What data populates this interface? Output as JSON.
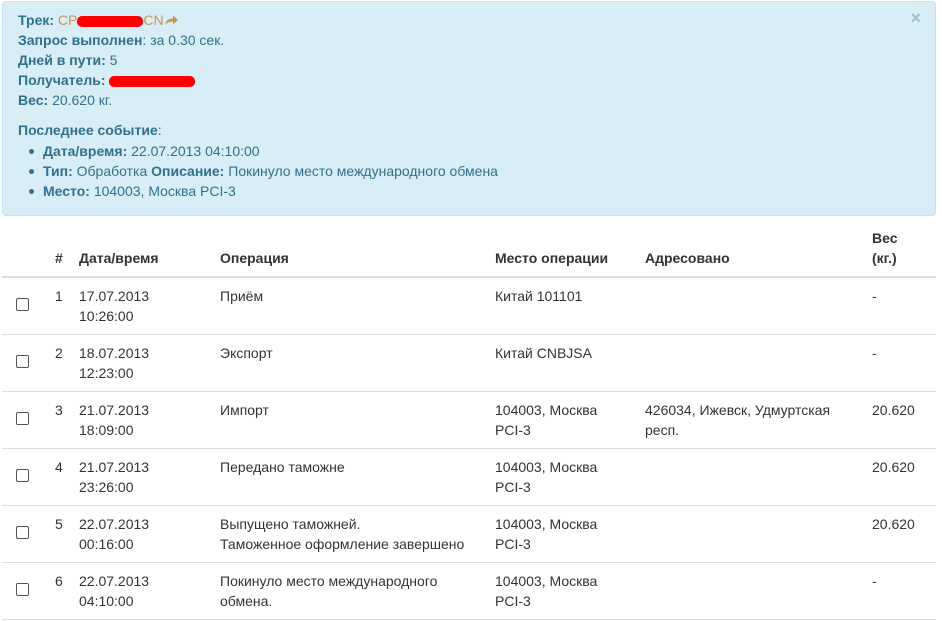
{
  "alert": {
    "track_label": "Трек:",
    "track_prefix": "CP",
    "track_suffix": "CN",
    "query_label": "Запрос выполнен",
    "query_value": ": за 0.30 сек.",
    "days_label": "Дней в пути:",
    "days_value": "5",
    "recipient_label": "Получатель:",
    "weight_label": "Вес:",
    "weight_value": "20.620 кг.",
    "last_event_label": "Последнее событие",
    "last_event_colon": ":",
    "event": {
      "datetime_label": "Дата/время:",
      "datetime_value": "22.07.2013 04:10:00",
      "type_label": "Тип:",
      "type_value": "Обработка",
      "desc_label": "Описание:",
      "desc_value": "Покинуло место международного обмена",
      "place_label": "Место:",
      "place_value": "104003, Москва PCI-3"
    },
    "close_symbol": "×",
    "colors": {
      "background": "#d9edf7",
      "text": "#31708f",
      "track_number": "#c09853",
      "redaction": "#ff0000"
    }
  },
  "table": {
    "headers": {
      "num": "#",
      "datetime": "Дата/время",
      "operation": "Операция",
      "place": "Место операции",
      "addressed": "Адресовано",
      "weight_line1": "Вес",
      "weight_line2": "(кг.)"
    },
    "rows": [
      {
        "num": "1",
        "date": "17.07.2013",
        "time": "10:26:00",
        "op1": "Приём",
        "op2": "",
        "place1": "Китай 101101",
        "place2": "",
        "addr1": "",
        "addr2": "",
        "weight": "-"
      },
      {
        "num": "2",
        "date": "18.07.2013",
        "time": "12:23:00",
        "op1": "Экспорт",
        "op2": "",
        "place1": "Китай CNBJSA",
        "place2": "",
        "addr1": "",
        "addr2": "",
        "weight": "-"
      },
      {
        "num": "3",
        "date": "21.07.2013",
        "time": "18:09:00",
        "op1": "Импорт",
        "op2": "",
        "place1": "104003, Москва",
        "place2": "PCI-3",
        "addr1": "426034, Ижевск, Удмуртская",
        "addr2": "респ.",
        "weight": "20.620"
      },
      {
        "num": "4",
        "date": "21.07.2013",
        "time": "23:26:00",
        "op1": "Передано таможне",
        "op2": "",
        "place1": "104003, Москва",
        "place2": "PCI-3",
        "addr1": "",
        "addr2": "",
        "weight": "20.620"
      },
      {
        "num": "5",
        "date": "22.07.2013",
        "time": "00:16:00",
        "op1": "Выпущено таможней.",
        "op2": "Таможенное оформление завершено",
        "place1": "104003, Москва",
        "place2": "PCI-3",
        "addr1": "",
        "addr2": "",
        "weight": "20.620"
      },
      {
        "num": "6",
        "date": "22.07.2013",
        "time": "04:10:00",
        "op1": "Покинуло место международного",
        "op2": "обмена.",
        "place1": "104003, Москва",
        "place2": "PCI-3",
        "addr1": "",
        "addr2": "",
        "weight": "-"
      }
    ]
  }
}
